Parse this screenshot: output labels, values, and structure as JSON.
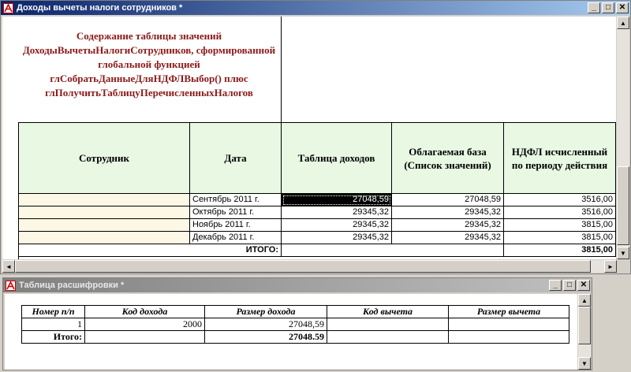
{
  "win1": {
    "title": "Доходы вычеты налоги сотрудников  *",
    "note": "Содержание таблицы значений ДоходыВычетыНалогиСотрудников, сформированной глобальной  функцией глСобратьДанныеДляНДФЛВыбор() плюс глПолучитьТаблицуПеречисленныхНалогов",
    "columns": [
      "Сотрудник",
      "Дата",
      "Таблица доходов",
      "Облагаемая база (Список значений)",
      "НДФЛ исчисленный по периоду действия"
    ],
    "rows": [
      {
        "date": "Сентябрь 2011 г.",
        "income": "27048,59",
        "base": "27048,59",
        "ndfl": "3516,00"
      },
      {
        "date": "Октябрь 2011 г.",
        "income": "29345,32",
        "base": "29345,32",
        "ndfl": "3516,00"
      },
      {
        "date": "Ноябрь 2011 г.",
        "income": "29345,32",
        "base": "29345,32",
        "ndfl": "3815,00"
      },
      {
        "date": "Декабрь 2011 г.",
        "income": "29345,32",
        "base": "29345,32",
        "ndfl": "3815,00"
      }
    ],
    "total_label": "ИТОГО:",
    "total_ndfl": "3815,00"
  },
  "win2": {
    "title": "Таблица расшифровки  *",
    "columns": [
      "Номер п/п",
      "Код дохода",
      "Размер дохода",
      "Код вычета",
      "Размер вычета"
    ],
    "row": {
      "num": "1",
      "code": "2000",
      "amount": "27048,59"
    },
    "total_label": "Итого:",
    "total_amount": "27048.59"
  },
  "colors": {
    "accent": "#0a246a",
    "note": "#8b1a1a",
    "header_bg": "#e8f8e3",
    "row_bg": "#fdf8e6"
  }
}
